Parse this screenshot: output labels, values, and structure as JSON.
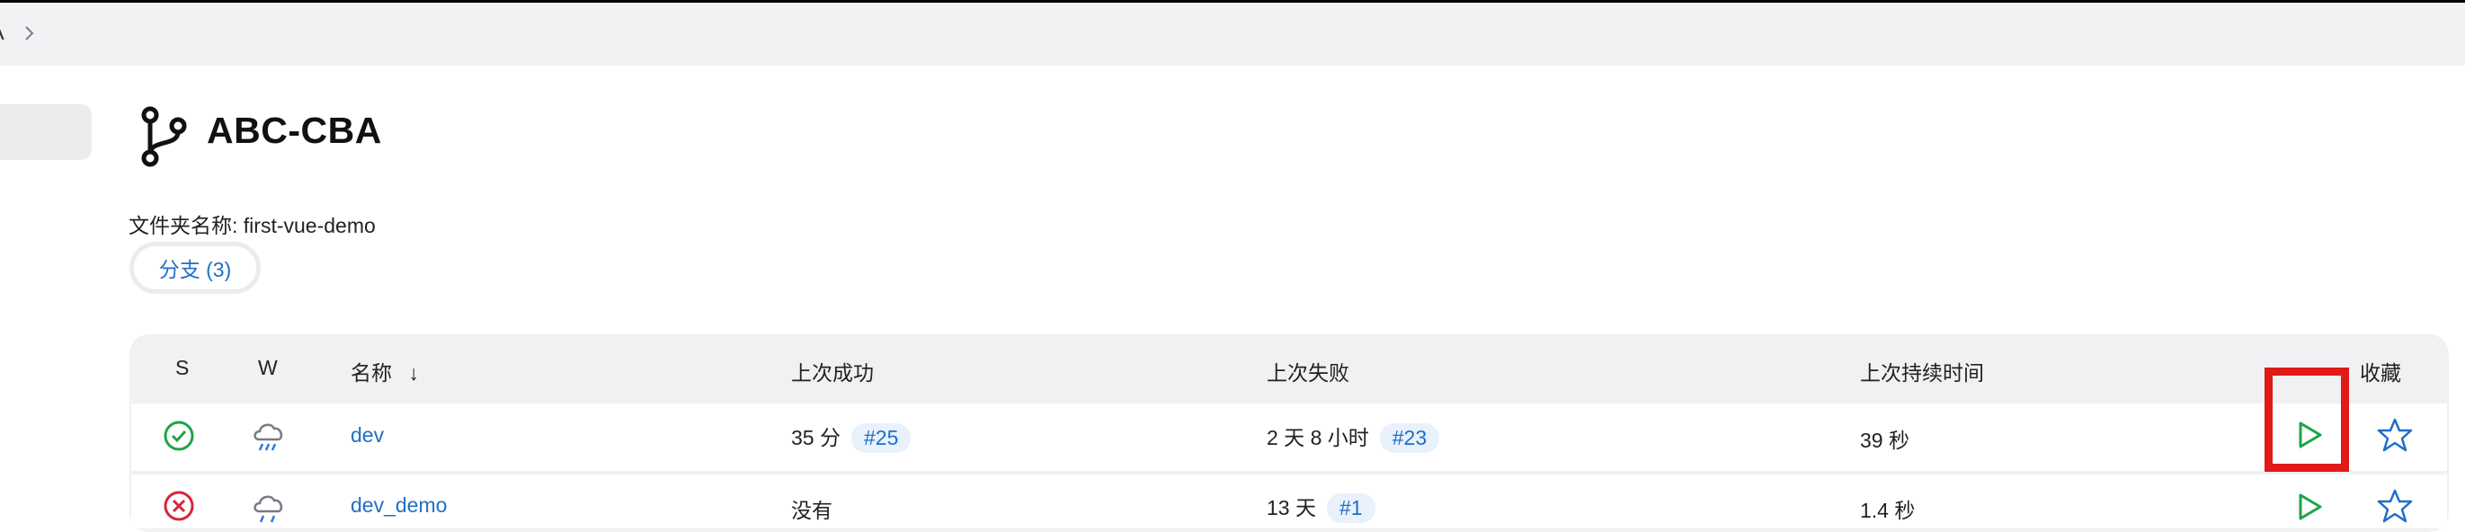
{
  "breadcrumb": {
    "partial_item": "A"
  },
  "page": {
    "title": "ABC-CBA",
    "folder_name": "文件夹名称: first-vue-demo",
    "tab_branches": "分支 (3)"
  },
  "table": {
    "headers": {
      "s": "S",
      "w": "W",
      "name": "名称",
      "sort_arrow": "↓",
      "last_success": "上次成功",
      "last_failure": "上次失败",
      "last_duration": "上次持续时间",
      "favorite": "收藏"
    },
    "rows": [
      {
        "status": "success",
        "weather": "rain-cloud-icon",
        "name": "dev",
        "last_success_time": "35 分",
        "last_success_build": "#25",
        "last_failure_time": "2 天 8 小时",
        "last_failure_build": "#23",
        "duration": "39 秒"
      },
      {
        "status": "failure",
        "weather": "storm-cloud-icon",
        "name": "dev_demo",
        "last_success_time": "没有",
        "last_success_build": "",
        "last_failure_time": "13 天",
        "last_failure_build": "#1",
        "duration": "1.4 秒"
      }
    ]
  },
  "colors": {
    "link": "#1f6fc6",
    "success": "#1ea446",
    "failure": "#d9253a",
    "highlight": "#e01919",
    "run": "#1ea446"
  }
}
